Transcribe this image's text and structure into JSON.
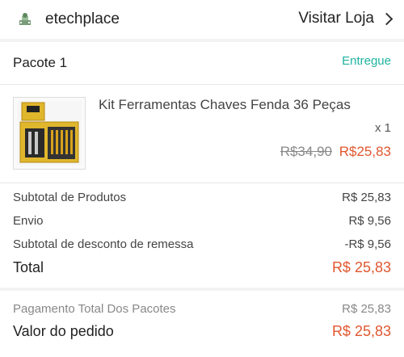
{
  "store": {
    "logo_icon": "store-logo-icon",
    "name": "etechplace",
    "visit_label": "Visitar Loja",
    "visit_icon": "chevron-right-icon"
  },
  "package": {
    "title": "Pacote 1",
    "status": "Entregue",
    "status_color": "#1fb3a0",
    "product": {
      "image_icon": "toolkit-product-image",
      "name": "Kit Ferramentas Chaves Fenda 36 Peças",
      "quantity": "x 1",
      "original_price": "R$34,90",
      "price": "R$25,83",
      "price_color": "#e0572f"
    },
    "breakdown": [
      {
        "label": "Subtotal de Produtos",
        "value": "R$ 25,83"
      },
      {
        "label": "Envio",
        "value": "R$ 9,56"
      },
      {
        "label": "Subtotal de desconto de remessa",
        "value": "-R$ 9,56"
      }
    ],
    "total": {
      "label": "Total",
      "value": "R$ 25,83"
    }
  },
  "summary": {
    "payment_label": "Pagamento Total Dos Pacotes",
    "payment_value": "R$ 25,83",
    "order_label": "Valor do pedido",
    "order_value": "R$ 25,83"
  }
}
